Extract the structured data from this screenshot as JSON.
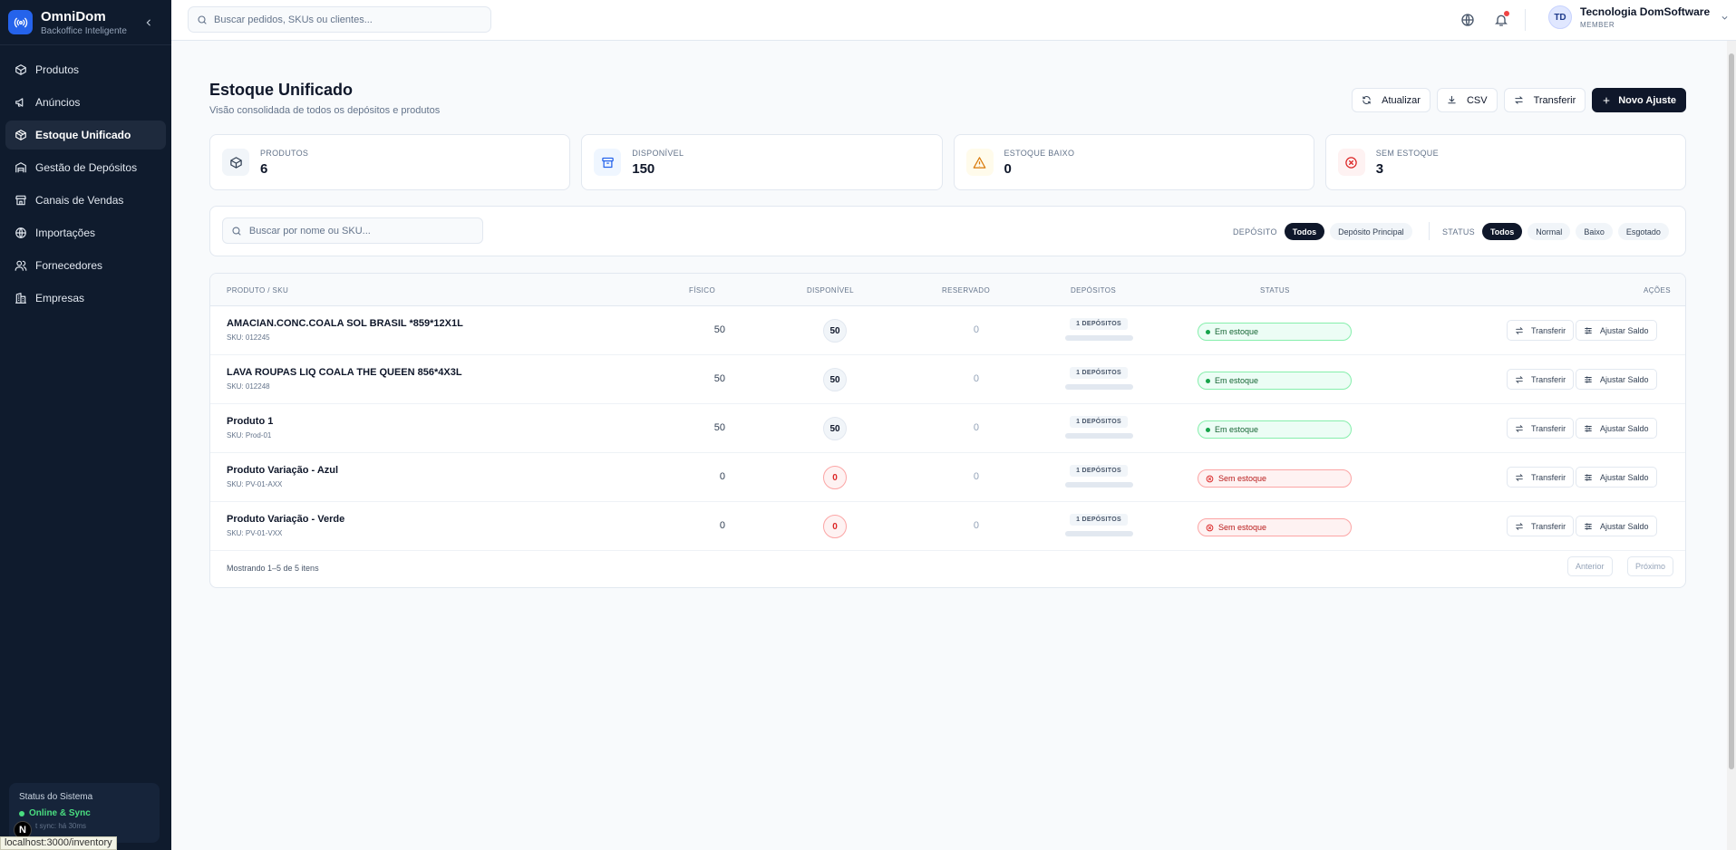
{
  "brand": {
    "name": "OmniDom",
    "subtitle": "Backoffice Inteligente"
  },
  "sidebar": {
    "items": [
      {
        "label": "Produtos",
        "icon": "box-icon"
      },
      {
        "label": "Anúncios",
        "icon": "megaphone-icon"
      },
      {
        "label": "Estoque Unificado",
        "icon": "package-icon",
        "active": true
      },
      {
        "label": "Gestão de Depósitos",
        "icon": "warehouse-icon"
      },
      {
        "label": "Canais de Vendas",
        "icon": "store-icon"
      },
      {
        "label": "Importações",
        "icon": "globe-icon"
      },
      {
        "label": "Fornecedores",
        "icon": "users-icon"
      },
      {
        "label": "Empresas",
        "icon": "building-icon"
      }
    ],
    "status": {
      "title": "Status do Sistema",
      "online": "Online & Sync",
      "sync": "t sync: há 30ms"
    }
  },
  "browser": {
    "status_url": "localhost:3000/inventory",
    "badge": "N"
  },
  "topbar": {
    "search_placeholder": "Buscar pedidos, SKUs ou clientes...",
    "user": {
      "initials": "TD",
      "name": "Tecnologia DomSoftware",
      "role": "MEMBER"
    }
  },
  "page": {
    "title": "Estoque Unificado",
    "subtitle": "Visão consolidada de todos os depósitos e produtos"
  },
  "actions": {
    "refresh": "Atualizar",
    "csv": "CSV",
    "transfer": "Transferir",
    "new_adjust": "Novo Ajuste"
  },
  "stats": [
    {
      "label": "Produtos",
      "value": "6"
    },
    {
      "label": "Disponível",
      "value": "150"
    },
    {
      "label": "Estoque Baixo",
      "value": "0"
    },
    {
      "label": "Sem Estoque",
      "value": "3"
    }
  ],
  "filters": {
    "search_placeholder": "Buscar por nome ou SKU...",
    "deposit_label": "DEPÓSITO",
    "deposit_options": [
      "Todos",
      "Depósito Principal"
    ],
    "status_label": "STATUS",
    "status_options": [
      "Todos",
      "Normal",
      "Baixo",
      "Esgotado"
    ]
  },
  "table": {
    "columns": {
      "product": "Produto / SKU",
      "physical": "Físico",
      "available": "Disponível",
      "reserved": "Reservado",
      "deposits": "Depósitos",
      "status": "Status",
      "actions": "Ações"
    },
    "rows": [
      {
        "name": "AMACIAN.CONC.COALA SOL BRASIL *859*12X1L",
        "sku": "SKU: 012245",
        "physical": "50",
        "available": "50",
        "reserved": "0",
        "deposits": "1 DEPÓSITOS",
        "fill": 1,
        "status": "Em estoque",
        "ok": true
      },
      {
        "name": "LAVA ROUPAS LIQ COALA THE QUEEN 856*4X3L",
        "sku": "SKU: 012248",
        "physical": "50",
        "available": "50",
        "reserved": "0",
        "deposits": "1 DEPÓSITOS",
        "fill": 1,
        "status": "Em estoque",
        "ok": true
      },
      {
        "name": "Produto 1",
        "sku": "SKU: Prod-01",
        "physical": "50",
        "available": "50",
        "reserved": "0",
        "deposits": "1 DEPÓSITOS",
        "fill": 1,
        "status": "Em estoque",
        "ok": true
      },
      {
        "name": "Produto Variação - Azul",
        "sku": "SKU: PV-01-AXX",
        "physical": "0",
        "available": "0",
        "reserved": "0",
        "deposits": "1 DEPÓSITOS",
        "fill": 0,
        "status": "Sem estoque",
        "ok": false
      },
      {
        "name": "Produto Variação - Verde",
        "sku": "SKU: PV-01-VXX",
        "physical": "0",
        "available": "0",
        "reserved": "0",
        "deposits": "1 DEPÓSITOS",
        "fill": 0,
        "status": "Sem estoque",
        "ok": false
      }
    ],
    "row_actions": {
      "transfer": "Transferir",
      "adjust": "Ajustar Saldo"
    },
    "footer": "Mostrando 1–5 de 5 itens",
    "prev": "Anterior",
    "next": "Próximo"
  }
}
